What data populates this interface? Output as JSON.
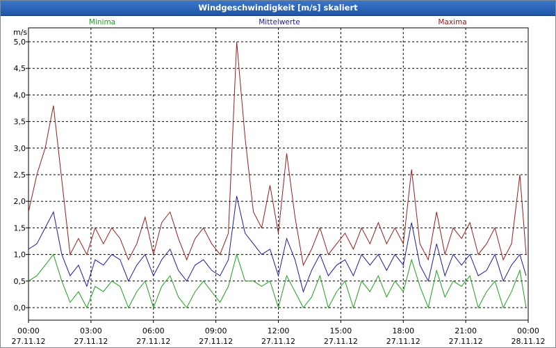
{
  "window": {
    "title": "Windgeschwindigkeit [m/s] skaliert"
  },
  "colors": {
    "minima": "#1aa31a",
    "mittelwerte": "#1a1aaa",
    "maxima": "#a01a1a",
    "grid": "#000000",
    "title_bar": "#2a62b8"
  },
  "chart_data": {
    "type": "line",
    "title": "Windgeschwindigkeit [m/s] skaliert",
    "ylabel": "m/s",
    "xlabel": "",
    "ylim": [
      0,
      5
    ],
    "y_ticks": [
      "0,0",
      "0,5",
      "1,0",
      "1,5",
      "2,0",
      "2,5",
      "3,0",
      "3,5",
      "4,0",
      "4,5",
      "5,0"
    ],
    "x_ticks": [
      {
        "time": "00:00",
        "date": "27.11.12"
      },
      {
        "time": "03:00",
        "date": "27.11.12"
      },
      {
        "time": "06:00",
        "date": "27.11.12"
      },
      {
        "time": "09:00",
        "date": "27.11.12"
      },
      {
        "time": "12:00",
        "date": "27.11.12"
      },
      {
        "time": "15:00",
        "date": "27.11.12"
      },
      {
        "time": "18:00",
        "date": "27.11.12"
      },
      {
        "time": "21:00",
        "date": "27.11.12"
      },
      {
        "time": "00:00",
        "date": "28.11.12"
      }
    ],
    "grid": true,
    "x_start": "27.11.12 00:00",
    "x_end": "28.11.12 00:00",
    "x_unit": "hours",
    "x": [
      0,
      0.4,
      0.8,
      1.2,
      1.6,
      2.0,
      2.4,
      2.8,
      3.2,
      3.6,
      4.0,
      4.4,
      4.8,
      5.2,
      5.6,
      6.0,
      6.4,
      6.8,
      7.2,
      7.6,
      8.0,
      8.4,
      8.8,
      9.2,
      9.6,
      10.0,
      10.4,
      10.8,
      11.2,
      11.6,
      12.0,
      12.4,
      12.8,
      13.2,
      13.6,
      14.0,
      14.4,
      14.8,
      15.2,
      15.6,
      16.0,
      16.4,
      16.8,
      17.2,
      17.6,
      18.0,
      18.4,
      18.8,
      19.2,
      19.6,
      20.0,
      20.4,
      20.8,
      21.2,
      21.6,
      22.0,
      22.4,
      22.8,
      23.2,
      23.6,
      23.9
    ],
    "series": [
      {
        "name": "Maxima",
        "values": [
          1.8,
          2.5,
          3.0,
          3.8,
          2.4,
          1.0,
          1.3,
          1.0,
          1.5,
          1.2,
          1.5,
          1.3,
          0.9,
          1.2,
          1.7,
          1.0,
          1.6,
          1.8,
          1.3,
          0.9,
          1.3,
          1.5,
          1.2,
          1.0,
          1.4,
          5.0,
          3.2,
          1.8,
          1.5,
          2.3,
          1.4,
          2.9,
          1.7,
          0.8,
          1.1,
          1.5,
          1.0,
          1.2,
          1.4,
          1.1,
          1.5,
          1.2,
          1.6,
          1.2,
          1.5,
          1.2,
          2.6,
          1.2,
          0.9,
          1.8,
          1.0,
          1.5,
          1.3,
          1.6,
          1.0,
          1.2,
          1.5,
          0.9,
          1.2,
          2.5,
          1.0
        ]
      },
      {
        "name": "Mittelwerte",
        "values": [
          1.1,
          1.2,
          1.5,
          1.8,
          1.0,
          0.6,
          0.8,
          0.4,
          0.9,
          0.8,
          1.0,
          0.9,
          0.5,
          0.8,
          1.0,
          0.6,
          0.9,
          1.1,
          0.7,
          0.5,
          0.8,
          0.9,
          0.7,
          0.6,
          0.9,
          2.1,
          1.4,
          1.2,
          1.0,
          1.1,
          0.6,
          1.3,
          0.9,
          0.3,
          0.7,
          1.0,
          0.6,
          0.8,
          0.9,
          0.6,
          1.0,
          0.8,
          1.0,
          0.7,
          1.0,
          0.8,
          1.6,
          0.8,
          0.5,
          1.2,
          0.6,
          1.0,
          0.8,
          1.0,
          0.6,
          0.7,
          1.0,
          0.5,
          0.8,
          1.0,
          0.6
        ]
      },
      {
        "name": "Minima",
        "values": [
          0.5,
          0.6,
          0.8,
          1.0,
          0.5,
          0.1,
          0.3,
          0.0,
          0.4,
          0.3,
          0.5,
          0.4,
          0.0,
          0.3,
          0.5,
          0.0,
          0.4,
          0.6,
          0.2,
          0.0,
          0.3,
          0.5,
          0.3,
          0.1,
          0.4,
          1.0,
          0.5,
          0.5,
          0.4,
          0.5,
          0.0,
          0.6,
          0.3,
          0.0,
          0.2,
          0.6,
          0.0,
          0.3,
          0.5,
          0.0,
          0.5,
          0.3,
          0.6,
          0.2,
          0.5,
          0.3,
          0.9,
          0.4,
          0.0,
          0.7,
          0.2,
          0.5,
          0.4,
          0.6,
          0.0,
          0.3,
          0.5,
          0.0,
          0.3,
          0.7,
          0.0
        ]
      }
    ]
  }
}
